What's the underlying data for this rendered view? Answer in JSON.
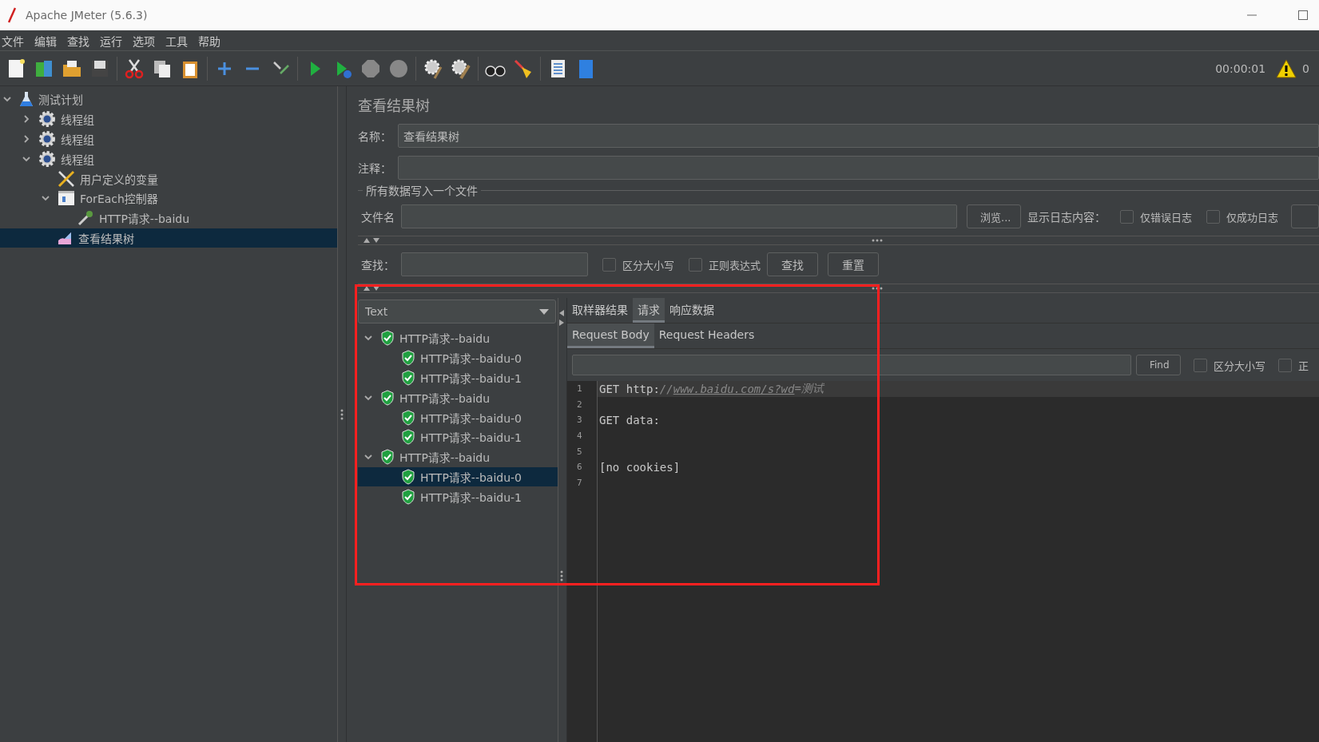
{
  "window": {
    "title": "Apache JMeter (5.6.3)"
  },
  "menu": [
    "文件",
    "编辑",
    "查找",
    "运行",
    "选项",
    "工具",
    "帮助"
  ],
  "status": {
    "elapsed": "00:00:01",
    "warnings": "0"
  },
  "tree": [
    {
      "label": "测试计划",
      "kind": "plan",
      "expanded": true,
      "selected": false,
      "children": [
        {
          "label": "线程组",
          "kind": "thread-group",
          "expanded": false,
          "selected": false
        },
        {
          "label": "线程组",
          "kind": "thread-group",
          "expanded": false,
          "selected": false
        },
        {
          "label": "线程组",
          "kind": "thread-group",
          "expanded": true,
          "selected": false,
          "children": [
            {
              "label": "用户定义的变量",
              "kind": "variables",
              "selected": false
            },
            {
              "label": "ForEach控制器",
              "kind": "controller",
              "expanded": true,
              "selected": false,
              "children": [
                {
                  "label": "HTTP请求--baidu",
                  "kind": "sampler",
                  "selected": false
                }
              ]
            },
            {
              "label": "查看结果树",
              "kind": "listener",
              "selected": true
            }
          ]
        }
      ]
    }
  ],
  "panel": {
    "title": "查看结果树",
    "name_label": "名称：",
    "name_value": "查看结果树",
    "comment_label": "注释：",
    "file_section": "所有数据写入一个文件",
    "file_label": "文件名",
    "browse_button": "浏览...",
    "log_label": "显示日志内容：",
    "log_options": [
      {
        "label": "仅错误日志",
        "checked": false
      },
      {
        "label": "仅成功日志",
        "checked": false
      }
    ],
    "search_label": "查找：",
    "search_options": [
      {
        "label": "区分大小写",
        "checked": false
      },
      {
        "label": "正则表达式",
        "checked": false
      }
    ],
    "find_button": "查找",
    "reset_button": "重置"
  },
  "results": {
    "renderer": "Text",
    "samples": [
      {
        "label": "HTTP请求--baidu",
        "expanded": true,
        "selected": false,
        "children": [
          {
            "label": "HTTP请求--baidu-0",
            "selected": false
          },
          {
            "label": "HTTP请求--baidu-1",
            "selected": false
          }
        ]
      },
      {
        "label": "HTTP请求--baidu",
        "expanded": true,
        "selected": false,
        "children": [
          {
            "label": "HTTP请求--baidu-0",
            "selected": false
          },
          {
            "label": "HTTP请求--baidu-1",
            "selected": false
          }
        ]
      },
      {
        "label": "HTTP请求--baidu",
        "expanded": true,
        "selected": false,
        "children": [
          {
            "label": "HTTP请求--baidu-0",
            "selected": true
          },
          {
            "label": "HTTP请求--baidu-1",
            "selected": false
          }
        ]
      }
    ],
    "tabs": [
      {
        "label": "取样器结果",
        "selected": false
      },
      {
        "label": "请求",
        "selected": true
      },
      {
        "label": "响应数据",
        "selected": false
      }
    ],
    "subtabs": [
      {
        "label": "Request Body",
        "selected": true
      },
      {
        "label": "Request Headers",
        "selected": false
      }
    ],
    "find_button": "Find",
    "find_options": [
      {
        "label": "区分大小写",
        "checked": false
      },
      {
        "label": "正",
        "checked": false
      }
    ],
    "lines": [
      {
        "number": "1",
        "highlighted": true,
        "segments": [
          {
            "text": "GET http:",
            "kind": "plain"
          },
          {
            "text": "//",
            "kind": "italic"
          },
          {
            "text": "www.baidu.com/s?wd",
            "kind": "link"
          },
          {
            "text": "=测试",
            "kind": "italic"
          }
        ]
      },
      {
        "number": "2",
        "highlighted": false
      },
      {
        "number": "3",
        "highlighted": false,
        "segments": [
          {
            "text": "GET data:",
            "kind": "plain"
          }
        ]
      },
      {
        "number": "4",
        "highlighted": false
      },
      {
        "number": "5",
        "highlighted": false
      },
      {
        "number": "6",
        "highlighted": false,
        "segments": [
          {
            "text": "[no cookies]",
            "kind": "plain"
          }
        ]
      },
      {
        "number": "7",
        "highlighted": false
      }
    ]
  },
  "annotation": {
    "kind": "rectangle",
    "color": "#ff2020"
  }
}
